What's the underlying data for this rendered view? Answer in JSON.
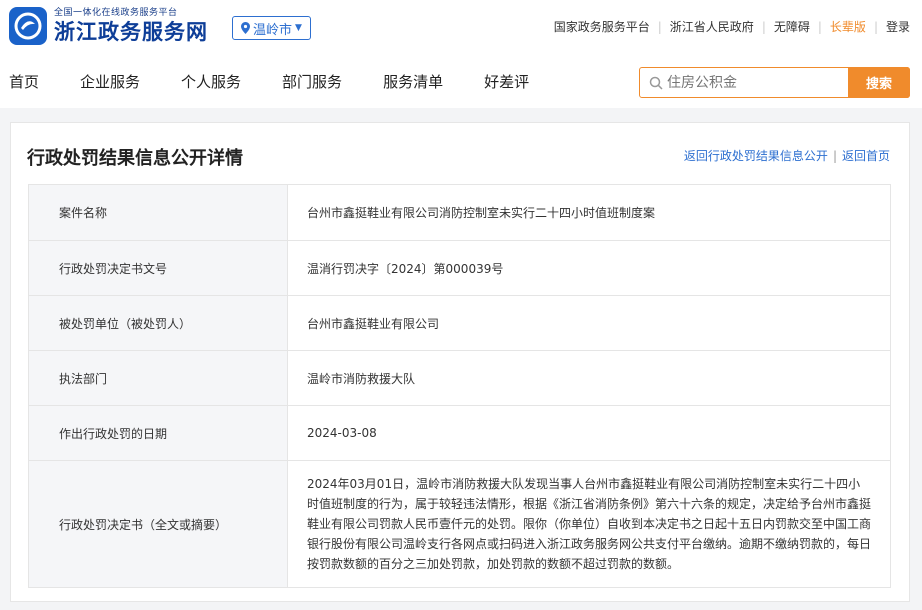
{
  "header": {
    "logo_sub": "全国一体化在线政务服务平台",
    "logo_main": "浙江政务服务网",
    "city": "温岭市",
    "top_links": [
      "国家政务服务平台",
      "浙江省人民政府",
      "无障碍",
      "长辈版",
      "登录"
    ]
  },
  "nav": {
    "items": [
      "首页",
      "企业服务",
      "个人服务",
      "部门服务",
      "服务清单",
      "好差评"
    ]
  },
  "search": {
    "placeholder": "住房公积金",
    "button": "搜索"
  },
  "page": {
    "title": "行政处罚结果信息公开详情",
    "back_list": "返回行政处罚结果信息公开",
    "back_home": "返回首页"
  },
  "rows": [
    {
      "label": "案件名称",
      "value": "台州市鑫挺鞋业有限公司消防控制室未实行二十四小时值班制度案"
    },
    {
      "label": "行政处罚决定书文号",
      "value": "温消行罚决字〔2024〕第000039号"
    },
    {
      "label": "被处罚单位（被处罚人）",
      "value": "台州市鑫挺鞋业有限公司"
    },
    {
      "label": "执法部门",
      "value": "温岭市消防救援大队"
    },
    {
      "label": "作出行政处罚的日期",
      "value": "2024-03-08"
    },
    {
      "label": "行政处罚决定书（全文或摘要）",
      "value": "2024年03月01日，温岭市消防救援大队发现当事人台州市鑫挺鞋业有限公司消防控制室未实行二十四小时值班制度的行为，属于较轻违法情形，根据《浙江省消防条例》第六十六条的规定，决定给予台州市鑫挺鞋业有限公司罚款人民币壹仟元的处罚。限你（你单位）自收到本决定书之日起十五日内罚款交至中国工商银行股份有限公司温岭支行各网点或扫码进入浙江政务服务网公共支付平台缴纳。逾期不缴纳罚款的，每日按罚款数额的百分之三加处罚款，加处罚款的数额不超过罚款的数额。"
    }
  ]
}
